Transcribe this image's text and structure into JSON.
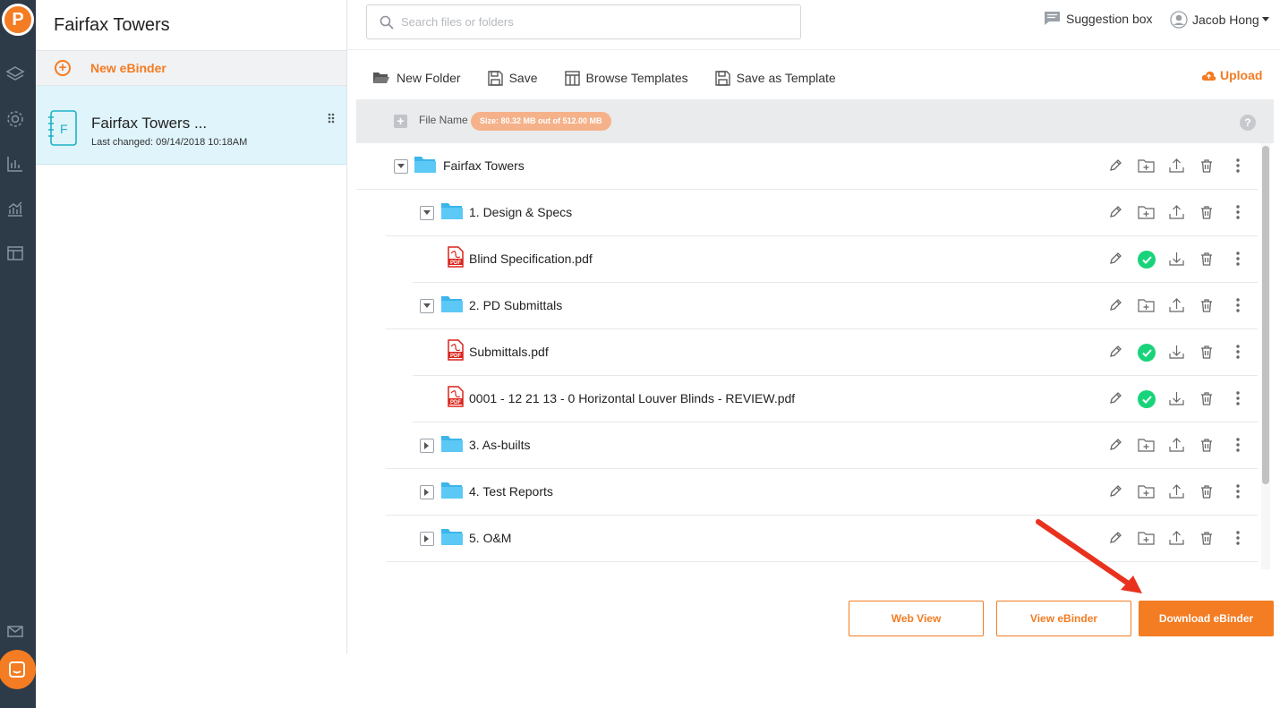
{
  "app": {
    "logo_letter": "P",
    "rail_icons": [
      "layers-icon",
      "gear-icon",
      "bar-chart-icon",
      "analytics-icon",
      "layout-icon",
      "mail-icon",
      "chat-icon"
    ],
    "accent_color": "#f47c22"
  },
  "binder_panel": {
    "title": "Fairfax Towers",
    "new_label": "New eBinder",
    "card": {
      "icon_letter": "F",
      "name": "Fairfax Towers ...",
      "last_changed": "Last changed: 09/14/2018 10:18AM"
    }
  },
  "header": {
    "search_placeholder": "Search files or folders",
    "suggestion_label": "Suggestion box",
    "user_name": "Jacob Hong"
  },
  "toolbar": {
    "new_folder": "New Folder",
    "save": "Save",
    "browse_templates": "Browse Templates",
    "save_as_template": "Save as Template",
    "upload": "Upload"
  },
  "table": {
    "column_name": "File Name",
    "size_badge": "Size: 80.32 MB out of 512.00 MB",
    "help": "?"
  },
  "tree": [
    {
      "name": "Fairfax Towers",
      "type": "folder",
      "expanded": true,
      "level": 0
    },
    {
      "name": "1. Design & Specs",
      "type": "folder",
      "expanded": true,
      "level": 1
    },
    {
      "name": "Blind Specification.pdf",
      "type": "pdf",
      "level": 2,
      "approved": true
    },
    {
      "name": "2. PD Submittals",
      "type": "folder",
      "expanded": true,
      "level": 1
    },
    {
      "name": "Submittals.pdf",
      "type": "pdf",
      "level": 2,
      "approved": true
    },
    {
      "name": "0001 - 12 21 13 - 0 Horizontal Louver Blinds - REVIEW.pdf",
      "type": "pdf",
      "level": 2,
      "approved": true
    },
    {
      "name": "3. As-builts",
      "type": "folder",
      "expanded": false,
      "level": 1
    },
    {
      "name": "4. Test Reports",
      "type": "folder",
      "expanded": false,
      "level": 1
    },
    {
      "name": "5. O&M",
      "type": "folder",
      "expanded": false,
      "level": 1
    }
  ],
  "buttons": {
    "web_view": "Web View",
    "view_ebinder": "View eBinder",
    "download_ebinder": "Download eBinder"
  }
}
